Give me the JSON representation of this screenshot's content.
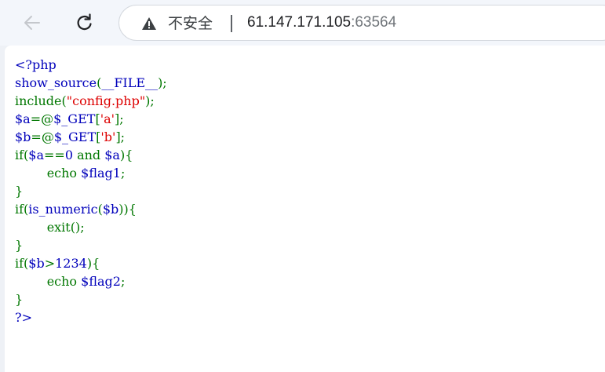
{
  "browser": {
    "security_label": "不安全",
    "url_host": "61.147.171.105",
    "url_port": ":63564"
  },
  "source_lines": [
    [
      {
        "t": "<?php",
        "c": "default"
      }
    ],
    [
      {
        "t": "show_source",
        "c": "default"
      },
      {
        "t": "(",
        "c": "keyword"
      },
      {
        "t": "__FILE__",
        "c": "default"
      },
      {
        "t": ");",
        "c": "keyword"
      }
    ],
    [
      {
        "t": "include(",
        "c": "keyword"
      },
      {
        "t": "\"config.php\"",
        "c": "string"
      },
      {
        "t": ");",
        "c": "keyword"
      }
    ],
    [
      {
        "t": "$a",
        "c": "default"
      },
      {
        "t": "=@",
        "c": "keyword"
      },
      {
        "t": "$_GET",
        "c": "default"
      },
      {
        "t": "[",
        "c": "keyword"
      },
      {
        "t": "'a'",
        "c": "string"
      },
      {
        "t": "];",
        "c": "keyword"
      }
    ],
    [
      {
        "t": "$b",
        "c": "default"
      },
      {
        "t": "=@",
        "c": "keyword"
      },
      {
        "t": "$_GET",
        "c": "default"
      },
      {
        "t": "[",
        "c": "keyword"
      },
      {
        "t": "'b'",
        "c": "string"
      },
      {
        "t": "];",
        "c": "keyword"
      }
    ],
    [
      {
        "t": "if(",
        "c": "keyword"
      },
      {
        "t": "$a",
        "c": "default"
      },
      {
        "t": "==",
        "c": "keyword"
      },
      {
        "t": "0 ",
        "c": "default"
      },
      {
        "t": "and ",
        "c": "keyword"
      },
      {
        "t": "$a",
        "c": "default"
      },
      {
        "t": "){",
        "c": "keyword"
      }
    ],
    [
      {
        "t": "        echo ",
        "c": "keyword"
      },
      {
        "t": "$flag1",
        "c": "default"
      },
      {
        "t": ";",
        "c": "keyword"
      }
    ],
    [
      {
        "t": "}",
        "c": "keyword"
      }
    ],
    [
      {
        "t": "if(",
        "c": "keyword"
      },
      {
        "t": "is_numeric",
        "c": "default"
      },
      {
        "t": "(",
        "c": "keyword"
      },
      {
        "t": "$b",
        "c": "default"
      },
      {
        "t": ")){",
        "c": "keyword"
      }
    ],
    [
      {
        "t": "        exit",
        "c": "keyword"
      },
      {
        "t": "();",
        "c": "keyword"
      }
    ],
    [
      {
        "t": "}",
        "c": "keyword"
      }
    ],
    [
      {
        "t": "if(",
        "c": "keyword"
      },
      {
        "t": "$b",
        "c": "default"
      },
      {
        "t": ">",
        "c": "keyword"
      },
      {
        "t": "1234",
        "c": "default"
      },
      {
        "t": "){",
        "c": "keyword"
      }
    ],
    [
      {
        "t": "        echo ",
        "c": "keyword"
      },
      {
        "t": "$flag2",
        "c": "default"
      },
      {
        "t": ";",
        "c": "keyword"
      }
    ],
    [
      {
        "t": "}",
        "c": "keyword"
      }
    ],
    [
      {
        "t": "?>",
        "c": "default"
      }
    ]
  ],
  "colors": {
    "default": "#0000bb",
    "keyword": "#007700",
    "string": "#dd0000"
  }
}
